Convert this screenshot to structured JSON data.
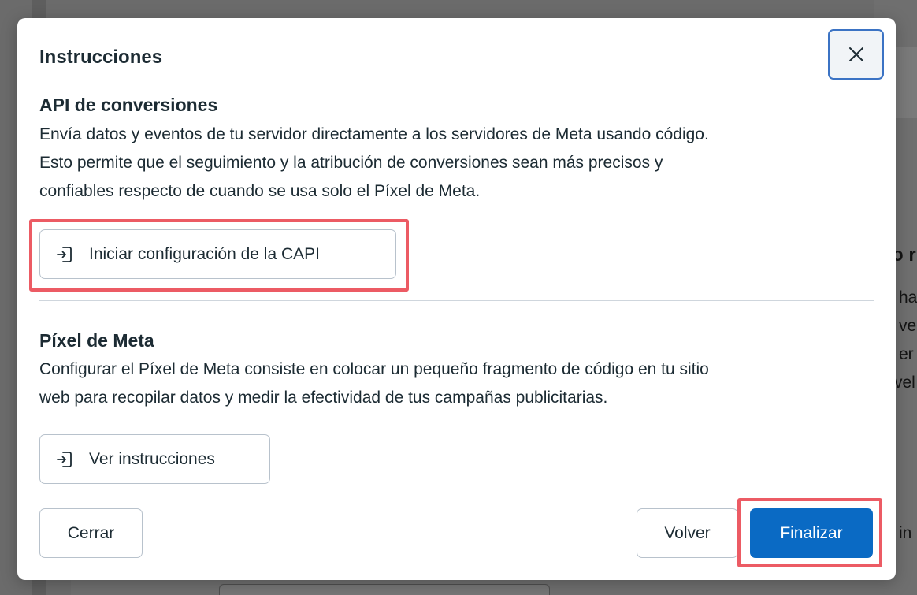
{
  "background": {
    "fragments": [
      "o r",
      "ha",
      "ve",
      "er",
      "vel",
      "in"
    ]
  },
  "dialog": {
    "title": "Instrucciones",
    "close_icon": "close-icon",
    "capi": {
      "title": "API de conversiones",
      "lines": [
        "Envía datos y eventos de tu servidor directamente a los servidores de Meta usando código.",
        "Esto permite que el seguimiento y la atribución de conversiones sean más precisos y",
        "confiables respecto de cuando se usa solo el Píxel de Meta."
      ],
      "button_label": "Iniciar configuración de la CAPI",
      "button_icon": "sign-in-icon"
    },
    "pixel": {
      "title": "Píxel de Meta",
      "lines": [
        "Configurar el Píxel de Meta consiste en colocar un pequeño fragmento de código en tu sitio",
        "web para recopilar datos y medir la efectividad de tus campañas publicitarias."
      ],
      "button_label": "Ver instrucciones",
      "button_icon": "sign-in-icon"
    },
    "footer": {
      "close_label": "Cerrar",
      "back_label": "Volver",
      "finish_label": "Finalizar"
    }
  },
  "colors": {
    "primary": "#0a6ac4",
    "highlight": "#ec5b64",
    "focus_ring": "#3b73c4",
    "text": "#1c2b33"
  }
}
